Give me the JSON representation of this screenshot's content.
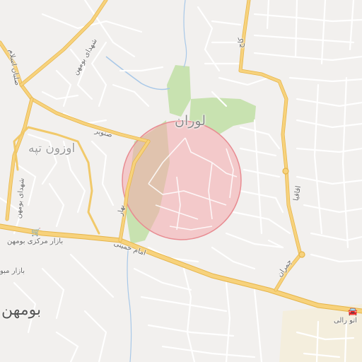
{
  "map": {
    "places": {
      "lavaran": "لوران",
      "ozoun_tappeh": "اوزون تپه",
      "boumehen": "بومهن"
    },
    "roads": {
      "shohada_boumehen_top": "شهدای بومهن",
      "shohada_boumehen_left": "شهدای بومهن",
      "saleban_eslam": "صلبان اسلام",
      "sanobar": "صنوبر",
      "imam_khomeini": "امام خمینی",
      "golhaye_kaj": "کاج",
      "aghaghia": "اقاقیا",
      "chamran": "چمران",
      "bahar": "بهار"
    },
    "pois": {
      "bazaar_markazi": "بازار مرکزی بومهن",
      "bazaar_left": "بازار مبو",
      "auto_gallery": "اتو رالی"
    },
    "icons": {
      "shopping": "shopping-cart-icon",
      "car": "car-icon"
    },
    "colors": {
      "background": "#f2f0ee",
      "major_road": "#f7d27c",
      "minor_road": "#ffffff",
      "park": "#c8e2b0",
      "highlight_fill": "#f4a9ad",
      "highlight_stroke": "#e88c92"
    }
  }
}
